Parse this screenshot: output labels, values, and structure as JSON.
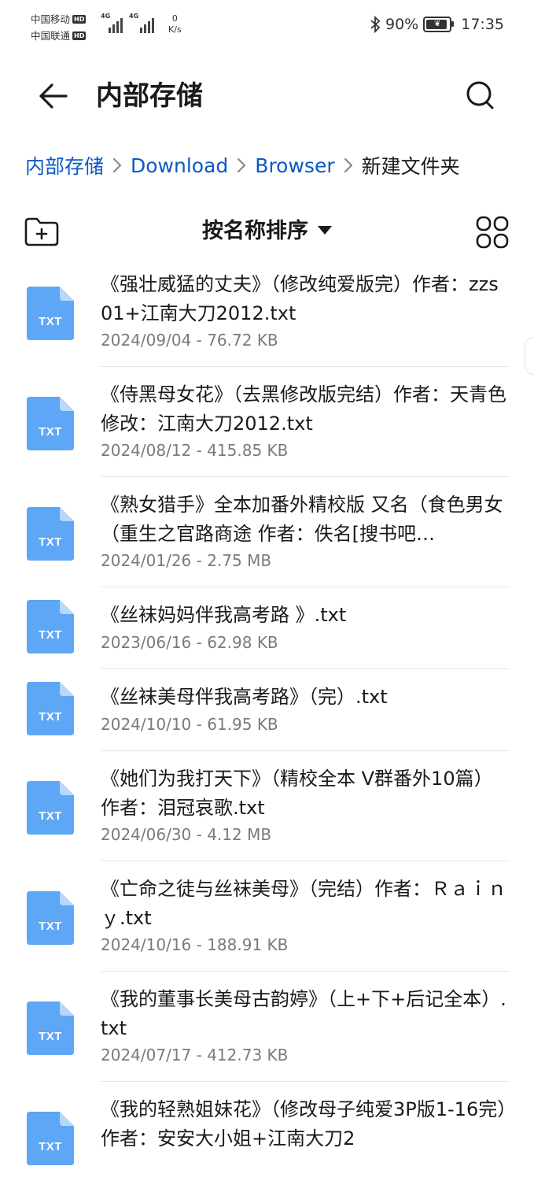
{
  "status_bar": {
    "carrier1": "中国移动",
    "carrier2": "中国联通",
    "hd": "HD",
    "net1": "4G",
    "net2": "4G",
    "speed_value": "0",
    "speed_unit": "K/s",
    "battery": "90%",
    "time": "17:35"
  },
  "header": {
    "title": "内部存储"
  },
  "breadcrumb": [
    {
      "label": "内部存储"
    },
    {
      "label": "Download"
    },
    {
      "label": "Browser"
    },
    {
      "label": "新建文件夹"
    }
  ],
  "toolbar": {
    "sort_label": "按名称排序"
  },
  "file_icon_label": "TXT",
  "colors": {
    "accent": "#0a59c7",
    "file_icon": "#5ea6f6",
    "file_icon_fold": "#b7d7fb"
  },
  "files": [
    {
      "name": "《强壮威猛的丈夫》（修改纯爱版完）作者：zzs01+江南大刀2012.txt",
      "meta": "2024/09/04 - 76.72 KB"
    },
    {
      "name": "《侍黑母女花》（去黑修改版完结）作者：天青色 修改：江南大刀2012.txt",
      "meta": "2024/08/12 - 415.85 KB"
    },
    {
      "name": "《熟女猎手》全本加番外精校版 又名（食色男女（重生之官路商途 作者：佚名[搜书吧…",
      "meta": "2024/01/26 - 2.75 MB"
    },
    {
      "name": "《丝袜妈妈伴我高考路 》.txt",
      "meta": "2023/06/16 - 62.98 KB"
    },
    {
      "name": "《丝袜美母伴我高考路》（完）.txt",
      "meta": "2024/10/10 - 61.95 KB"
    },
    {
      "name": "《她们为我打天下》（精校全本 V群番外10篇）作者：泪冠哀歌.txt",
      "meta": "2024/06/30 - 4.12 MB"
    },
    {
      "name": "《亡命之徒与丝袜美母》（完结）作者：Ｒａｉｎｙ.txt",
      "meta": "2024/10/16 - 188.91 KB"
    },
    {
      "name": "《我的董事长美母古韵婷》（上+下+后记全本）.txt",
      "meta": "2024/07/17 - 412.73 KB"
    },
    {
      "name": "《我的轻熟姐妹花》（修改母子纯爱3P版1-16完）作者：安安大小姐+江南大刀2",
      "meta": ""
    }
  ]
}
